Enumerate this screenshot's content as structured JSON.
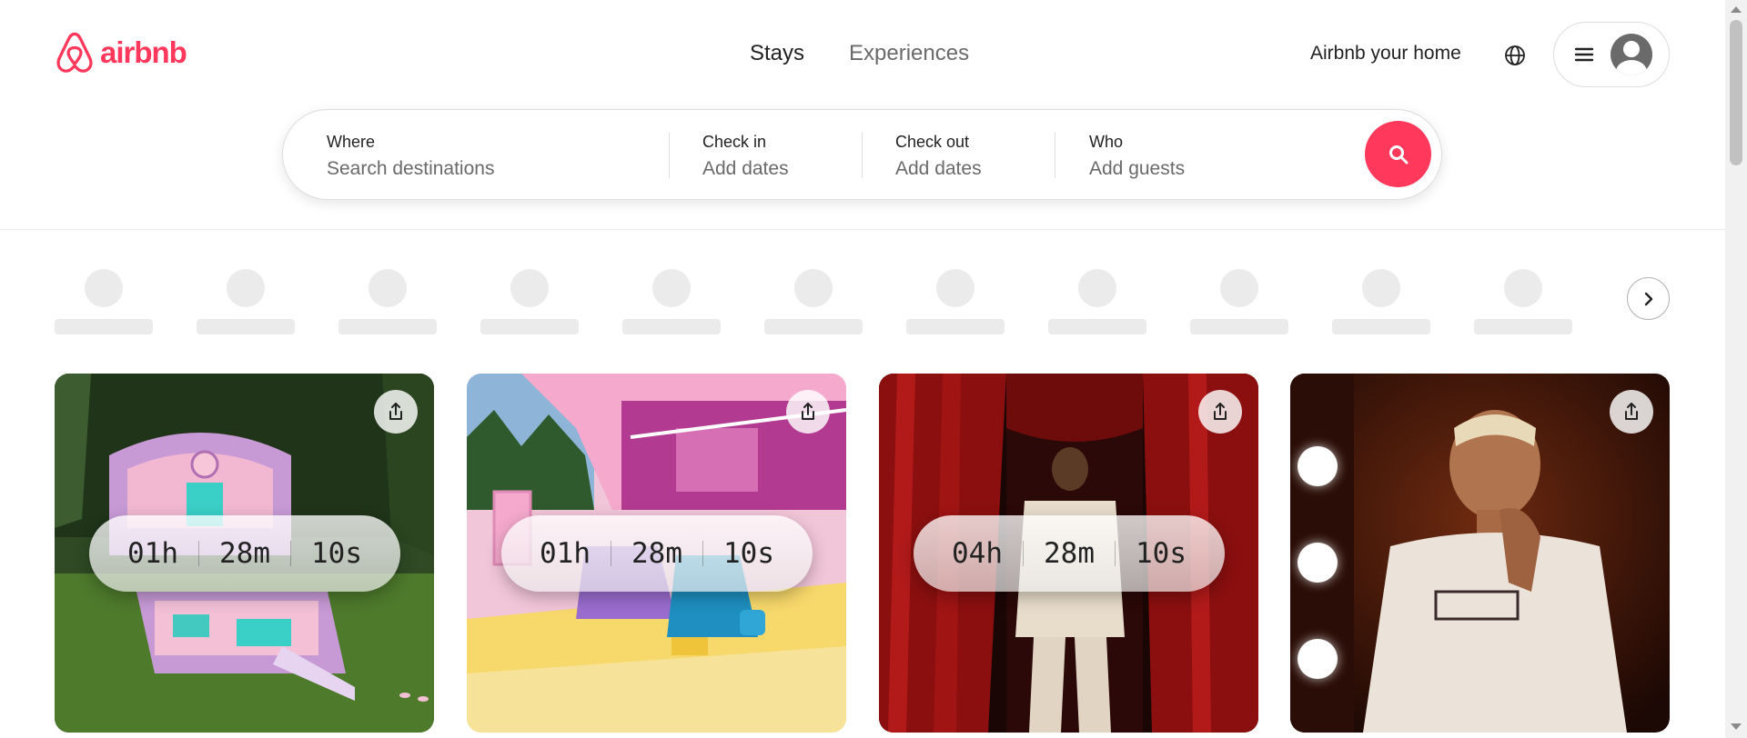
{
  "brand": {
    "name": "airbnb",
    "color": "#ff385c"
  },
  "nav": {
    "tabs": [
      {
        "label": "Stays",
        "active": true
      },
      {
        "label": "Experiences",
        "active": false
      }
    ]
  },
  "header_actions": {
    "host_link": "Airbnb your home",
    "globe_icon": "globe-icon",
    "menu_icon": "hamburger-menu-icon",
    "avatar_icon": "user-avatar-icon"
  },
  "search": {
    "where": {
      "label": "Where",
      "placeholder": "Search destinations"
    },
    "check_in": {
      "label": "Check in",
      "placeholder": "Add dates"
    },
    "check_out": {
      "label": "Check out",
      "placeholder": "Add dates"
    },
    "who": {
      "label": "Who",
      "placeholder": "Add guests"
    },
    "button_icon": "search-icon"
  },
  "categories": {
    "loading": true,
    "next_icon": "chevron-right-icon"
  },
  "cards": [
    {
      "countdown": {
        "hours": "01h",
        "minutes": "28m",
        "seconds": "10s"
      },
      "share_icon": "share-icon"
    },
    {
      "countdown": {
        "hours": "01h",
        "minutes": "28m",
        "seconds": "10s"
      },
      "share_icon": "share-icon"
    },
    {
      "countdown": {
        "hours": "04h",
        "minutes": "28m",
        "seconds": "10s"
      },
      "share_icon": "share-icon"
    },
    {
      "share_icon": "share-icon"
    }
  ]
}
